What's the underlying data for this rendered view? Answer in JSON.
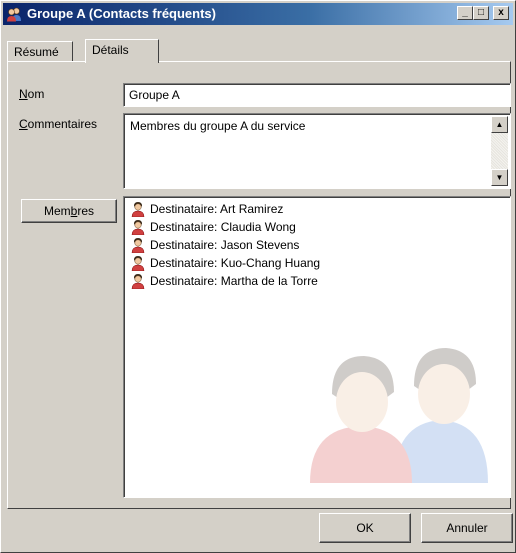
{
  "window": {
    "title": "Groupe A (Contacts fréquents)",
    "controls": {
      "minimize": "_",
      "maximize": "□",
      "close": "x"
    }
  },
  "tabs": [
    {
      "label": "Résumé",
      "active": false
    },
    {
      "label": "Détails",
      "active": true
    }
  ],
  "form": {
    "nom_label_mnemonic": "N",
    "nom_label_rest": "om",
    "nom_value": "Groupe A",
    "commentaires_label_mnemonic": "C",
    "commentaires_label_rest": "ommentaires",
    "commentaires_value": "Membres du groupe A du service",
    "membres_button_a": "Mem",
    "membres_button_mnemonic": "b",
    "membres_button_b": "res"
  },
  "members": [
    {
      "label": "Destinataire: Art Ramirez",
      "icon": "contact-icon"
    },
    {
      "label": "Destinataire: Claudia Wong",
      "icon": "contact-icon"
    },
    {
      "label": "Destinataire: Jason Stevens",
      "icon": "contact-icon"
    },
    {
      "label": "Destinataire: Kuo-Chang Huang",
      "icon": "contact-icon"
    },
    {
      "label": "Destinataire: Martha de la Torre",
      "icon": "contact-icon"
    }
  ],
  "buttons": {
    "ok": "OK",
    "cancel": "Annuler"
  },
  "colors": {
    "titlebar_start": "#0a246a",
    "titlebar_end": "#a6caf0",
    "face": "#d4d0c8"
  }
}
